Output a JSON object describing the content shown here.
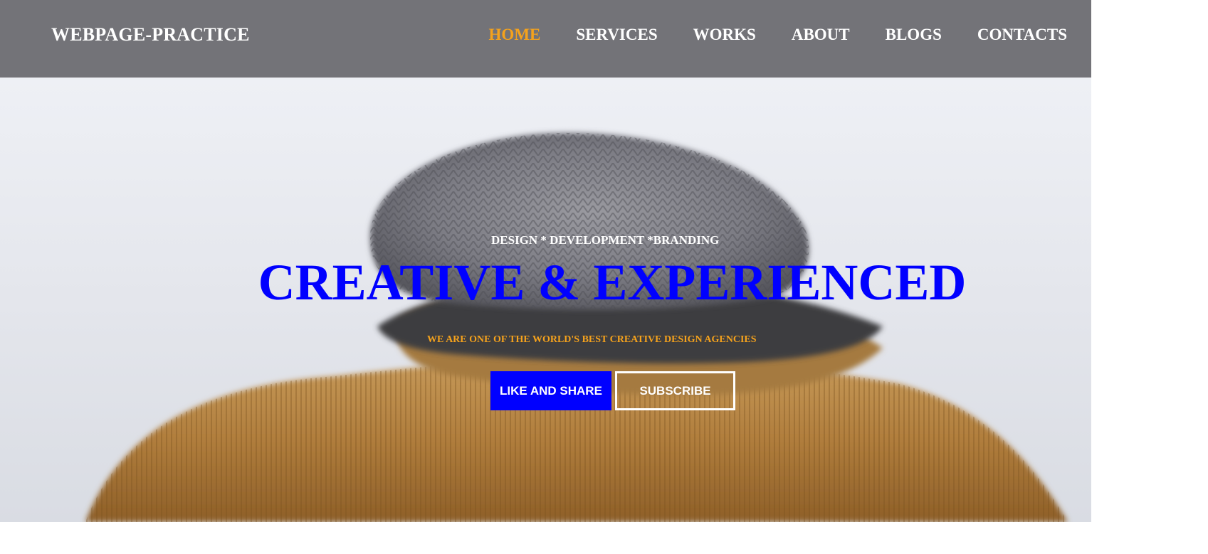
{
  "header": {
    "brand": "WEBPAGE-PRACTICE",
    "nav": [
      {
        "label": "HOME",
        "active": true
      },
      {
        "label": "SERVICES",
        "active": false
      },
      {
        "label": "WORKS",
        "active": false
      },
      {
        "label": "ABOUT",
        "active": false
      },
      {
        "label": "BLOGS",
        "active": false
      },
      {
        "label": "CONTACTS",
        "active": false
      }
    ]
  },
  "hero": {
    "tagline": "DESIGN * DEVELOPMENT *BRANDING",
    "headline": "CREATIVE & EXPERIENCED",
    "subline": "WE ARE ONE OF THE WORLD'S BEST CREATIVE DESIGN AGENCIES",
    "primary_button": "LIKE AND SHARE",
    "secondary_button": "SUBSCRIBE"
  },
  "colors": {
    "header_bg": "#737378",
    "accent_orange": "#f5a21c",
    "accent_blue": "#0000ff",
    "text_white": "#ffffff"
  }
}
